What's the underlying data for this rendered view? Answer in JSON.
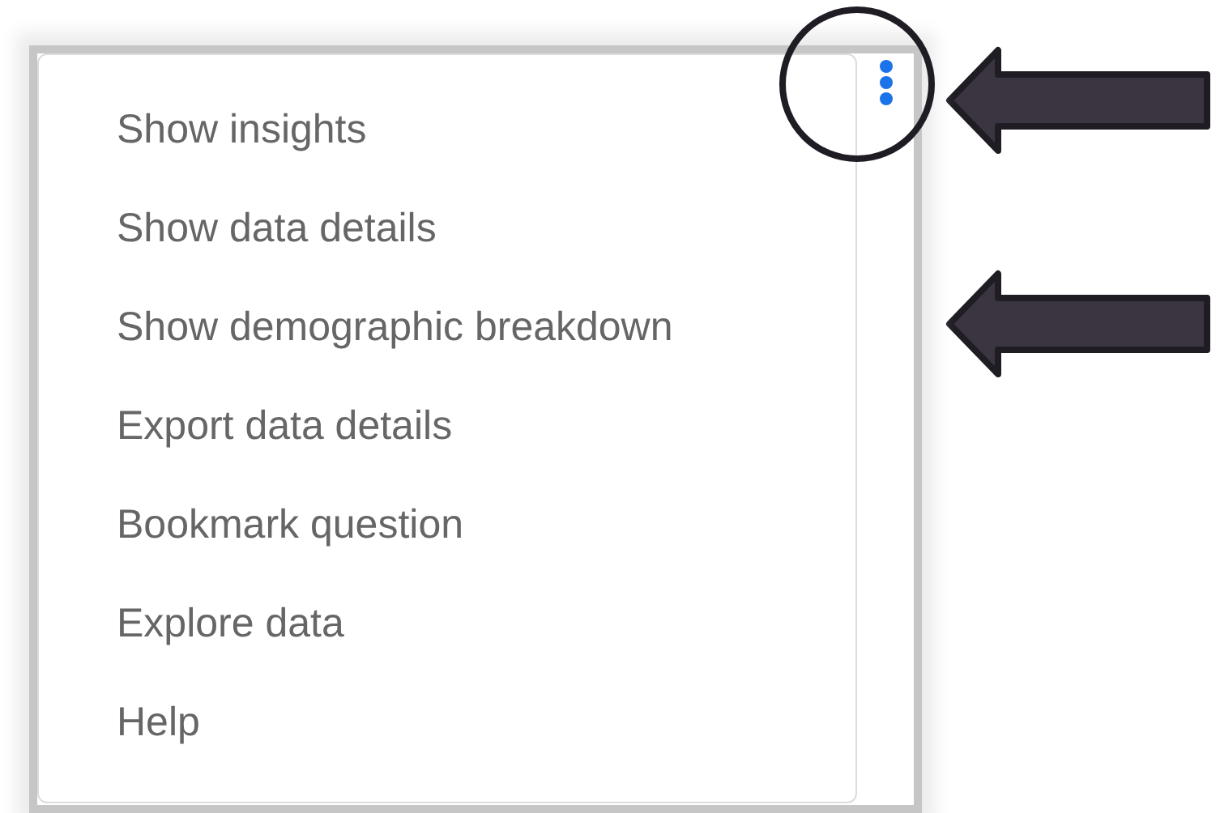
{
  "menu": {
    "items": [
      {
        "label": "Show insights"
      },
      {
        "label": "Show data details"
      },
      {
        "label": "Show demographic breakdown"
      },
      {
        "label": "Export data details"
      },
      {
        "label": "Bookmark question"
      },
      {
        "label": "Explore data"
      },
      {
        "label": "Help"
      }
    ]
  }
}
